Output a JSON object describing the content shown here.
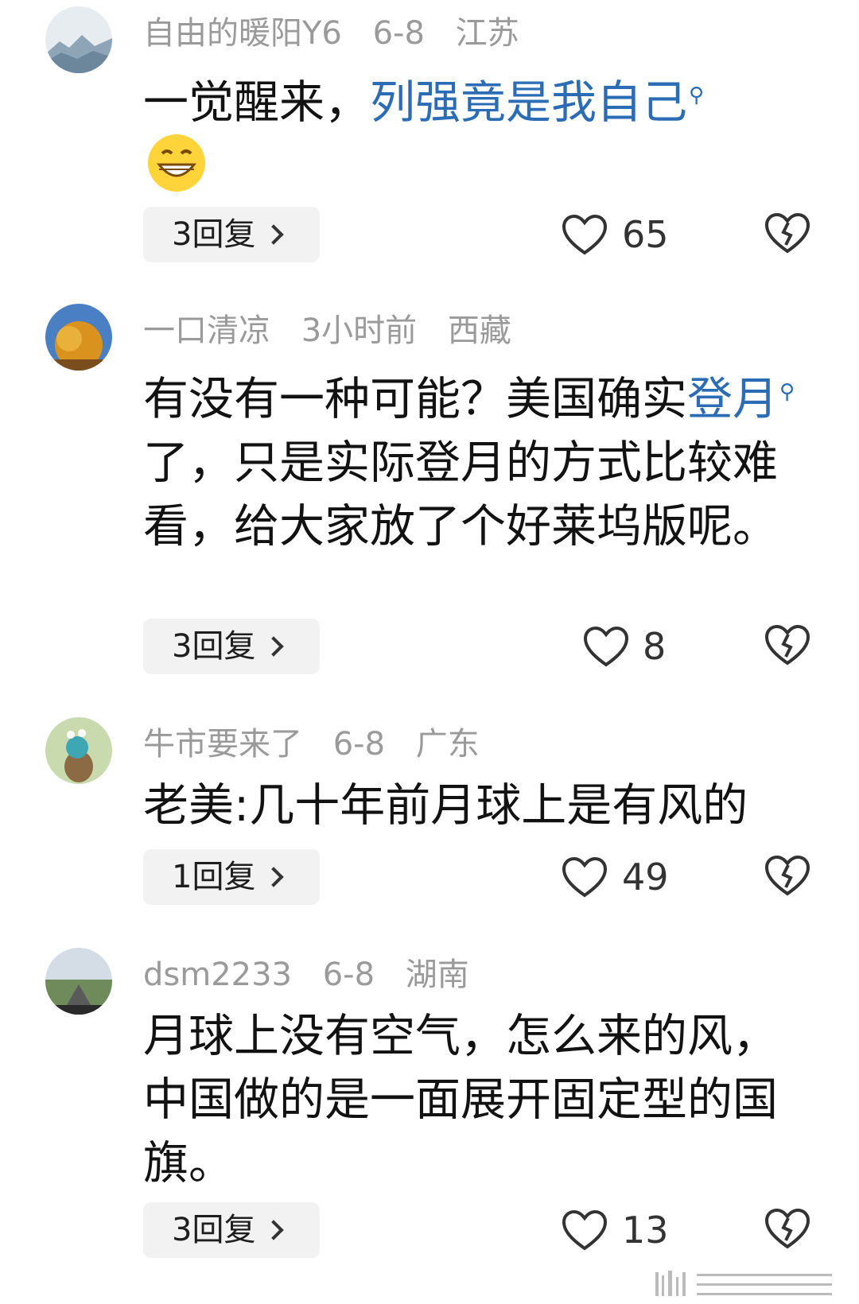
{
  "comments": [
    {
      "username": "自由的暖阳Y6",
      "date": "6-8",
      "location": "江苏",
      "text_parts": [
        {
          "text": "一觉醒来，",
          "link": false
        },
        {
          "text": "列强竟是我自己",
          "link": true
        }
      ],
      "emoji": "grinning-face",
      "replies": "3回复",
      "likes": "65"
    },
    {
      "username": "一口清凉",
      "date": "3小时前",
      "location": "西藏",
      "text_line1": "有没有一种可能？美国确实",
      "text_link": "登月",
      "text_rest": "了，只是实际登月的方式比较难看，给大家放了个好莱坞版呢。",
      "replies": "3回复",
      "likes": "8"
    },
    {
      "username": "牛市要来了",
      "date": "6-8",
      "location": "广东",
      "text": "老美:几十年前月球上是有风的",
      "replies": "1回复",
      "likes": "49"
    },
    {
      "username": "dsm2233",
      "date": "6-8",
      "location": "湖南",
      "text": "月球上没有空气，怎么来的风，中国做的是一面展开固定型的国旗。",
      "replies": "3回复",
      "likes": "13"
    }
  ],
  "icons": {
    "like": "heart-outline-icon",
    "dislike": "broken-heart-icon",
    "search_marker": "search-icon"
  },
  "colors": {
    "link": "#2b6cb4",
    "meta": "#9a9a9a",
    "reply_bg": "#f2f2f2"
  }
}
